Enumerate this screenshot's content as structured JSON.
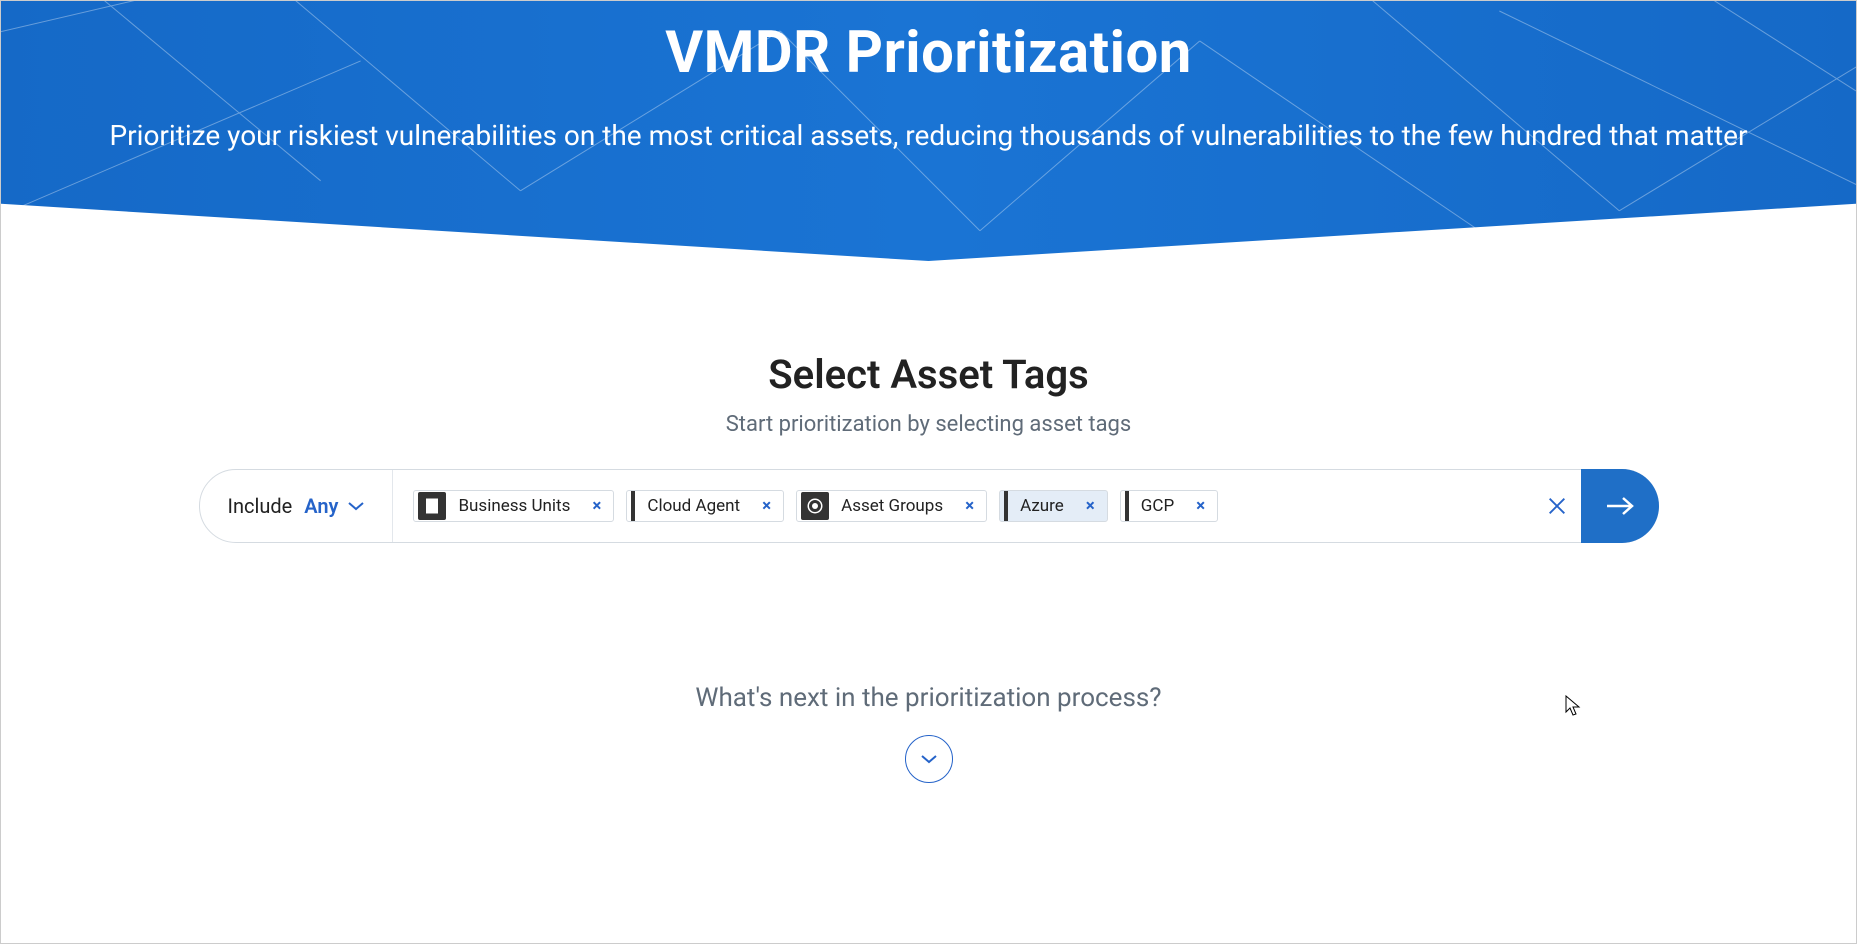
{
  "hero": {
    "title": "VMDR Prioritization",
    "subtitle": "Prioritize your riskiest vulnerabilities on the most critical assets, reducing thousands of vulnerabilities to the few hundred that matter"
  },
  "section": {
    "title": "Select Asset Tags",
    "subtitle": "Start prioritization by selecting asset tags"
  },
  "tagbar": {
    "include_label": "Include",
    "include_mode": "Any",
    "tags": [
      {
        "label": "Business Units",
        "icon": "building-icon",
        "style": "icon"
      },
      {
        "label": "Cloud Agent",
        "icon": null,
        "style": "stripe"
      },
      {
        "label": "Asset Groups",
        "icon": "target-icon",
        "style": "icon"
      },
      {
        "label": "Azure",
        "icon": null,
        "style": "stripe",
        "variant": "azure"
      },
      {
        "label": "GCP",
        "icon": null,
        "style": "stripe"
      }
    ]
  },
  "footer": {
    "prompt": "What's next in the prioritization process?"
  }
}
